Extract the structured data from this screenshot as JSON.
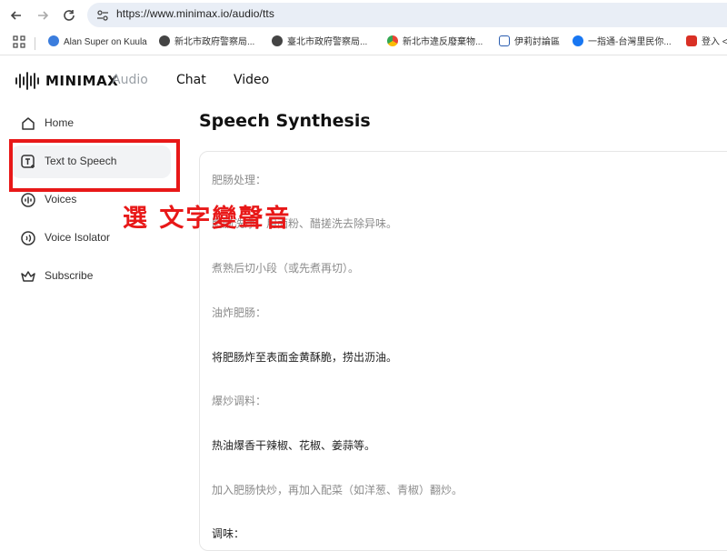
{
  "browser": {
    "url": "https://www.minimax.io/audio/tts",
    "bookmarks": [
      {
        "label": "Alan Super on Kuula",
        "icon": "kuula-icon",
        "color": "#3b7ddd"
      },
      {
        "label": "新北市政府警察局...",
        "icon": "police-icon",
        "color": "#444444"
      },
      {
        "label": "臺北市政府警察局...",
        "icon": "police-icon",
        "color": "#444444"
      },
      {
        "label": "新北市違反廢棄物...",
        "icon": "chrome-icon",
        "color": "#34a853"
      },
      {
        "label": "伊莉討論區",
        "icon": "forum-icon",
        "color": "#2a5db0"
      },
      {
        "label": "一指通-台灣里民你...",
        "icon": "facebook-icon",
        "color": "#1877f2"
      },
      {
        "label": "登入 <",
        "icon": "login-icon",
        "color": "#d93025"
      }
    ]
  },
  "header": {
    "brand": "MINIMAX",
    "tabs": [
      {
        "label": "Audio",
        "active": true
      },
      {
        "label": "Chat",
        "active": false
      },
      {
        "label": "Video",
        "active": false
      }
    ]
  },
  "sidebar": {
    "items": [
      {
        "label": "Home",
        "icon": "home-icon",
        "active": false
      },
      {
        "label": "Text to Speech",
        "icon": "text-to-speech-icon",
        "active": true
      },
      {
        "label": "Voices",
        "icon": "voices-icon",
        "active": false
      },
      {
        "label": "Voice Isolator",
        "icon": "voice-isolator-icon",
        "active": false
      },
      {
        "label": "Subscribe",
        "icon": "crown-icon",
        "active": false
      }
    ]
  },
  "annotation": {
    "text": "選 文字變聲音",
    "color": "#e81818"
  },
  "main": {
    "title": "Speech Synthesis",
    "lines": [
      {
        "text": "肥肠处理：",
        "tone": "grey"
      },
      {
        "text": "肥肠洗净，用面粉、醋搓洗去除异味。",
        "tone": "grey"
      },
      {
        "text": "煮熟后切小段（或先煮再切）。",
        "tone": "grey"
      },
      {
        "text": "油炸肥肠：",
        "tone": "grey"
      },
      {
        "text": "将肥肠炸至表面金黄酥脆，捞出沥油。",
        "tone": "dark"
      },
      {
        "text": "爆炒调料：",
        "tone": "grey"
      },
      {
        "text": "热油爆香干辣椒、花椒、姜蒜等。",
        "tone": "dark"
      },
      {
        "text": "加入肥肠快炒，再加入配菜（如洋葱、青椒）翻炒。",
        "tone": "grey"
      },
      {
        "text": "调味：",
        "tone": "dark"
      }
    ]
  }
}
